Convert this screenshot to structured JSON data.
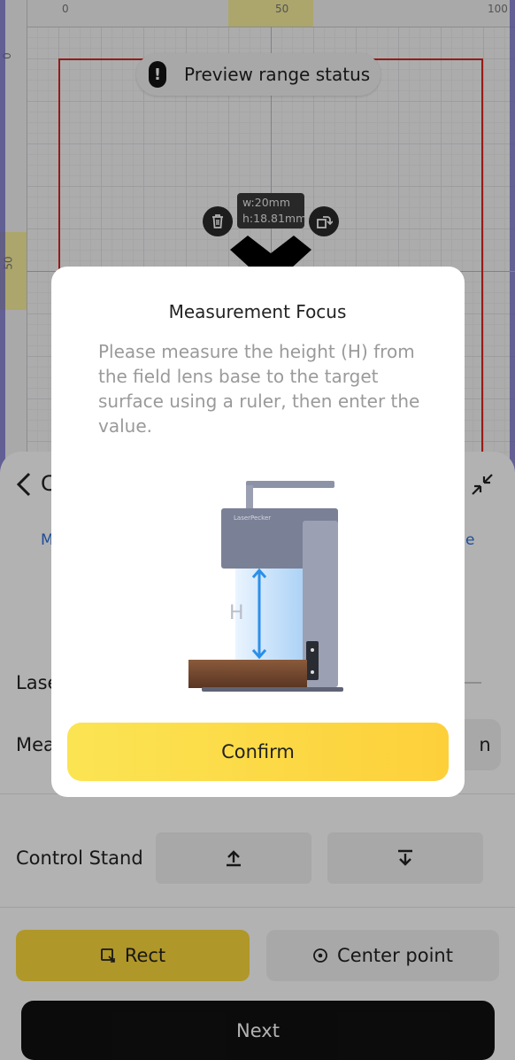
{
  "canvas": {
    "ruler_top_ticks": [
      "0",
      "50",
      "100"
    ],
    "ruler_left_ticks": [
      "0",
      "50"
    ],
    "preview_status": "Preview range status",
    "object_size": {
      "width": "w:20mm",
      "height": "h:18.81mm"
    }
  },
  "panel": {
    "back_title_partial": "C",
    "tab_left_partial": "M",
    "tab_right_partial": "e",
    "laser_label_partial": "Lase",
    "measure_label_partial": "Mea",
    "measure_button_partial": "n",
    "control_stand_label": "Control Stand",
    "rect_label": "Rect",
    "center_point_label": "Center point",
    "next_label": "Next"
  },
  "dialog": {
    "title": "Measurement Focus",
    "body": "Please measure the height (H) from the field lens base to the target surface using a ruler, then enter the value.",
    "device_brand": "LaserPecker",
    "height_marker": "H",
    "confirm_label": "Confirm"
  },
  "colors": {
    "accent_yellow": "#fcd93b",
    "frame_red": "#d8261f",
    "arrow_blue": "#2b8fe8"
  }
}
